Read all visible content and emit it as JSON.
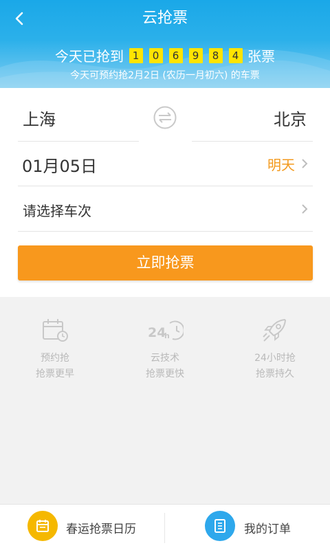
{
  "header": {
    "title": "云抢票",
    "counter_prefix": "今天已抢到",
    "counter_digits": [
      "1",
      "0",
      "6",
      "9",
      "8",
      "4"
    ],
    "counter_suffix": "张票",
    "subtitle": "今天可预约抢2月2日 (农历一月初六) 的车票"
  },
  "search": {
    "from_station": "上海",
    "to_station": "北京",
    "date": "01月05日",
    "date_hint": "明天",
    "train_placeholder": "请选择车次",
    "submit_label": "立即抢票"
  },
  "features": [
    {
      "icon": "calendar-clock-icon",
      "line1": "预约抢",
      "line2": "抢票更早"
    },
    {
      "icon": "24h-icon",
      "line1": "云技术",
      "line2": "抢票更快"
    },
    {
      "icon": "rocket-icon",
      "line1": "24小时抢",
      "line2": "抢票持久"
    }
  ],
  "bottom_nav": {
    "calendar_label": "春运抢票日历",
    "orders_label": "我的订单"
  },
  "colors": {
    "header_blue": "#1aa8e8",
    "accent_orange": "#f8981d",
    "digit_yellow": "#ffe400",
    "calendar_yellow": "#f5b800",
    "orders_blue": "#2ea8ec"
  }
}
